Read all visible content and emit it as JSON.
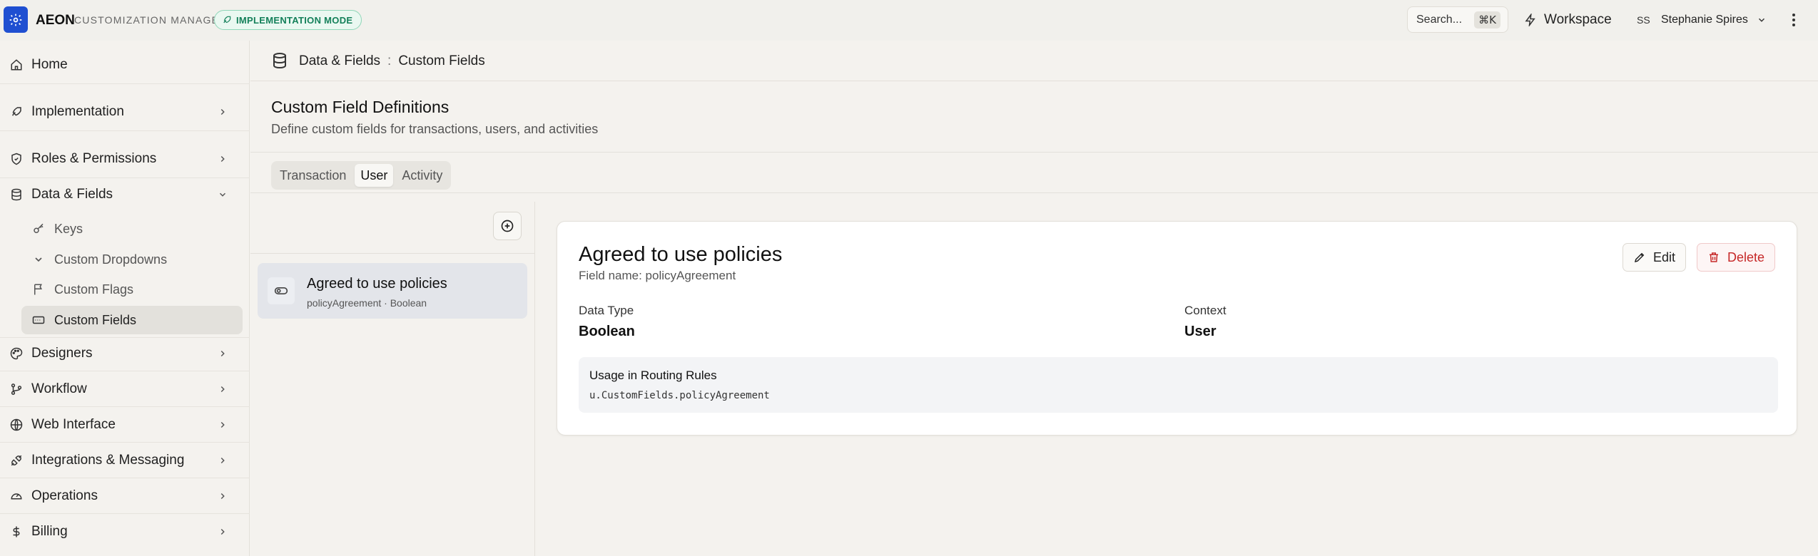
{
  "app": {
    "brand": "AEON",
    "subtitle": "CUSTOMIZATION MANAGER",
    "mode_badge": "IMPLEMENTATION MODE",
    "accent": "#1f4fd1"
  },
  "topbar": {
    "search_label": "Search...",
    "search_shortcut": "⌘K",
    "workspace_label": "Workspace",
    "user_initials": "SS",
    "user_name": "Stephanie Spires"
  },
  "sidebar": {
    "items": [
      {
        "label": "Home",
        "icon": "home-icon"
      },
      {
        "label": "Implementation",
        "icon": "rocket-icon"
      },
      {
        "label": "Roles & Permissions",
        "icon": "shield-icon"
      },
      {
        "label": "Data & Fields",
        "icon": "database-icon"
      },
      {
        "label": "Designers",
        "icon": "palette-icon"
      },
      {
        "label": "Workflow",
        "icon": "workflow-icon"
      },
      {
        "label": "Web Interface",
        "icon": "globe-icon"
      },
      {
        "label": "Integrations & Messaging",
        "icon": "plug-icon"
      },
      {
        "label": "Operations",
        "icon": "gauge-icon"
      },
      {
        "label": "Billing",
        "icon": "dollar-icon"
      }
    ],
    "sub_items": [
      {
        "label": "Keys",
        "icon": "key-icon"
      },
      {
        "label": "Custom Dropdowns",
        "icon": "chevron-down-icon"
      },
      {
        "label": "Custom Flags",
        "icon": "flag-icon"
      },
      {
        "label": "Custom Fields",
        "icon": "input-field-icon"
      }
    ]
  },
  "breadcrumb": {
    "parent": "Data & Fields",
    "separator": ":",
    "current": "Custom Fields"
  },
  "page": {
    "title": "Custom Field Definitions",
    "subtitle": "Define custom fields for transactions, users, and activities"
  },
  "tabs": [
    {
      "label": "Transaction",
      "active": false
    },
    {
      "label": "User",
      "active": true
    },
    {
      "label": "Activity",
      "active": false
    }
  ],
  "field_list": [
    {
      "title": "Agreed to use policies",
      "meta": "policyAgreement · Boolean",
      "icon": "toggle-icon"
    }
  ],
  "detail": {
    "title": "Agreed to use policies",
    "field_name": "Field name: policyAgreement",
    "edit_label": "Edit",
    "delete_label": "Delete",
    "data_type_label": "Data Type",
    "data_type_value": "Boolean",
    "context_label": "Context",
    "context_value": "User",
    "usage_title": "Usage in Routing Rules",
    "usage_code": "u.CustomFields.policyAgreement"
  }
}
